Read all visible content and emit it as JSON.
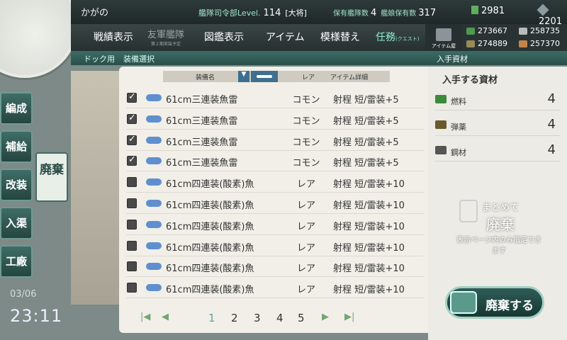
{
  "header": {
    "player_name": "かがの",
    "hq_label": "艦隊司令部Level.",
    "hq_level": "114",
    "rank": "[大将]",
    "ships_label": "保有艦隊数",
    "ships_value": "4",
    "girls_label": "艦娘保有数",
    "girls_value": "317",
    "bucket_value": "2981",
    "devmat_value": "2201"
  },
  "menu": {
    "items": [
      "戦績表示",
      "友軍艦隊",
      "図鑑表示",
      "アイテム",
      "模様替え",
      "任務"
    ],
    "disabled_sub": "第２期実装予定",
    "quest_sub": "(クエスト)",
    "item_shop": "アイテム屋"
  },
  "resources": {
    "fuel": "273667",
    "ammo": "274889",
    "steel": "258735",
    "bauxite": "257370"
  },
  "subbar": {
    "left": "ドック用",
    "title": "装備選択",
    "right_title": "入手資材"
  },
  "nav": {
    "items": [
      "編成",
      "補給",
      "改装",
      "入渠",
      "工廠"
    ],
    "scrap": "廃棄"
  },
  "clock": {
    "date": "03/06",
    "time": "23:11"
  },
  "list": {
    "header": {
      "name": "装備名",
      "rarity": "レア",
      "detail": "アイテム詳細"
    },
    "rows": [
      {
        "checked": true,
        "name": "61cm三連装魚雷",
        "rarity": "コモン",
        "detail": "射程 短/雷装+5"
      },
      {
        "checked": true,
        "name": "61cm三連装魚雷",
        "rarity": "コモン",
        "detail": "射程 短/雷装+5"
      },
      {
        "checked": true,
        "name": "61cm三連装魚雷",
        "rarity": "コモン",
        "detail": "射程 短/雷装+5"
      },
      {
        "checked": true,
        "name": "61cm三連装魚雷",
        "rarity": "コモン",
        "detail": "射程 短/雷装+5"
      },
      {
        "checked": false,
        "name": "61cm四連装(酸素)魚",
        "rarity": "レア",
        "detail": "射程 短/雷装+10"
      },
      {
        "checked": false,
        "name": "61cm四連装(酸素)魚",
        "rarity": "レア",
        "detail": "射程 短/雷装+10"
      },
      {
        "checked": false,
        "name": "61cm四連装(酸素)魚",
        "rarity": "レア",
        "detail": "射程 短/雷装+10"
      },
      {
        "checked": false,
        "name": "61cm四連装(酸素)魚",
        "rarity": "レア",
        "detail": "射程 短/雷装+10"
      },
      {
        "checked": false,
        "name": "61cm四連装(酸素)魚",
        "rarity": "レア",
        "detail": "射程 短/雷装+10"
      },
      {
        "checked": false,
        "name": "61cm四連装(酸素)魚",
        "rarity": "レア",
        "detail": "射程 短/雷装+10"
      }
    ],
    "pages": [
      "1",
      "2",
      "3",
      "4",
      "5"
    ],
    "current_page": "1"
  },
  "materials": {
    "title": "入手する資材",
    "items": [
      {
        "name": "燃料",
        "value": "4",
        "color": "#3c8a3c"
      },
      {
        "name": "弾薬",
        "value": "4",
        "color": "#6b5a2c"
      },
      {
        "name": "鋼材",
        "value": "4",
        "color": "#555555"
      }
    ],
    "bulk_title_1": "まとめて",
    "bulk_title_2": "廃棄",
    "bulk_note": "表示ページ内のみ指定できます",
    "dispose_button": "廃棄する"
  }
}
